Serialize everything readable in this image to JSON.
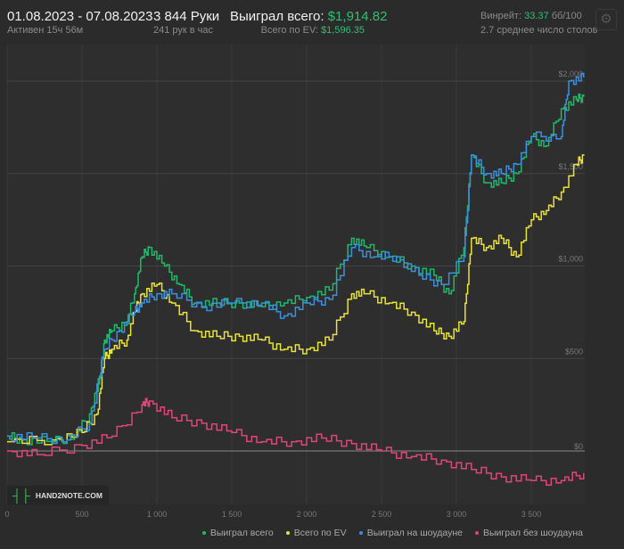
{
  "header": {
    "date_range": "01.08.2023 - 07.08.2023",
    "active": "Активен 15ч 56м",
    "hands": "3 844 Руки",
    "hands_per_hour": "241 рук в час",
    "won_label": "Выиграл всего:",
    "won_value": "$1,914.82",
    "ev_label": "Всего по EV:",
    "ev_value": "$1,596.35",
    "winrate_label": "Винрейт:",
    "winrate_value": "33.37",
    "winrate_unit": "бб/100",
    "tables": "2.7 среднее число столов",
    "settings_icon": "gear-icon"
  },
  "logo": "HAND2NOTE.COM",
  "chart_data": {
    "type": "line",
    "title": "",
    "xlabel": "",
    "ylabel": "",
    "xlim": [
      0,
      3850
    ],
    "ylim": [
      -300,
      2100
    ],
    "x_ticks": [
      "0",
      "500",
      "1 000",
      "1 500",
      "2 000",
      "2 500",
      "3 000",
      "3 500"
    ],
    "y_ticks": [
      "$0",
      "$500",
      "$1,000",
      "$1,500",
      "$2,000"
    ],
    "legend_position": "bottom-right",
    "series": [
      {
        "name": "Выиграл всего",
        "color": "#1fb86a",
        "points": [
          [
            0,
            80
          ],
          [
            100,
            60
          ],
          [
            300,
            50
          ],
          [
            450,
            80
          ],
          [
            550,
            200
          ],
          [
            620,
            400
          ],
          [
            650,
            600
          ],
          [
            700,
            650
          ],
          [
            800,
            700
          ],
          [
            850,
            850
          ],
          [
            900,
            1050
          ],
          [
            950,
            1100
          ],
          [
            1050,
            1000
          ],
          [
            1150,
            900
          ],
          [
            1250,
            800
          ],
          [
            1400,
            800
          ],
          [
            1550,
            800
          ],
          [
            1700,
            780
          ],
          [
            1850,
            800
          ],
          [
            2000,
            830
          ],
          [
            2150,
            870
          ],
          [
            2300,
            1150
          ],
          [
            2400,
            1100
          ],
          [
            2550,
            1050
          ],
          [
            2700,
            1000
          ],
          [
            2850,
            950
          ],
          [
            2950,
            850
          ],
          [
            3050,
            1100
          ],
          [
            3100,
            1600
          ],
          [
            3200,
            1450
          ],
          [
            3300,
            1450
          ],
          [
            3400,
            1500
          ],
          [
            3500,
            1700
          ],
          [
            3600,
            1650
          ],
          [
            3700,
            1850
          ],
          [
            3800,
            1900
          ],
          [
            3850,
            1915
          ]
        ]
      },
      {
        "name": "Всего по EV",
        "color": "#e8e23a",
        "points": [
          [
            0,
            50
          ],
          [
            300,
            60
          ],
          [
            500,
            100
          ],
          [
            600,
            200
          ],
          [
            650,
            500
          ],
          [
            700,
            550
          ],
          [
            800,
            600
          ],
          [
            850,
            750
          ],
          [
            900,
            850
          ],
          [
            1000,
            900
          ],
          [
            1100,
            800
          ],
          [
            1250,
            650
          ],
          [
            1400,
            620
          ],
          [
            1550,
            620
          ],
          [
            1700,
            600
          ],
          [
            1850,
            550
          ],
          [
            2000,
            550
          ],
          [
            2150,
            600
          ],
          [
            2300,
            850
          ],
          [
            2400,
            850
          ],
          [
            2550,
            800
          ],
          [
            2700,
            750
          ],
          [
            2850,
            650
          ],
          [
            2950,
            620
          ],
          [
            3050,
            700
          ],
          [
            3100,
            1150
          ],
          [
            3200,
            1100
          ],
          [
            3300,
            1150
          ],
          [
            3400,
            1050
          ],
          [
            3500,
            1250
          ],
          [
            3600,
            1300
          ],
          [
            3700,
            1400
          ],
          [
            3800,
            1550
          ],
          [
            3850,
            1596
          ]
        ]
      },
      {
        "name": "Выиграл на шоудауне",
        "color": "#3b8fe0",
        "points": [
          [
            0,
            80
          ],
          [
            200,
            70
          ],
          [
            400,
            60
          ],
          [
            550,
            150
          ],
          [
            650,
            550
          ],
          [
            750,
            650
          ],
          [
            850,
            750
          ],
          [
            900,
            800
          ],
          [
            1000,
            850
          ],
          [
            1100,
            850
          ],
          [
            1300,
            780
          ],
          [
            1500,
            800
          ],
          [
            1700,
            800
          ],
          [
            1850,
            730
          ],
          [
            2000,
            800
          ],
          [
            2150,
            820
          ],
          [
            2300,
            1100
          ],
          [
            2450,
            1050
          ],
          [
            2600,
            1050
          ],
          [
            2750,
            950
          ],
          [
            2900,
            900
          ],
          [
            3050,
            1050
          ],
          [
            3100,
            1600
          ],
          [
            3200,
            1500
          ],
          [
            3300,
            1500
          ],
          [
            3400,
            1550
          ],
          [
            3500,
            1700
          ],
          [
            3700,
            1700
          ],
          [
            3750,
            2000
          ],
          [
            3850,
            2020
          ]
        ]
      },
      {
        "name": "Выиграл без шоудауна",
        "color": "#e0457a",
        "points": [
          [
            0,
            0
          ],
          [
            200,
            -20
          ],
          [
            500,
            30
          ],
          [
            700,
            80
          ],
          [
            900,
            250
          ],
          [
            950,
            270
          ],
          [
            1100,
            180
          ],
          [
            1300,
            150
          ],
          [
            1500,
            100
          ],
          [
            1700,
            50
          ],
          [
            1900,
            50
          ],
          [
            2100,
            70
          ],
          [
            2300,
            40
          ],
          [
            2500,
            0
          ],
          [
            2700,
            -30
          ],
          [
            2900,
            -50
          ],
          [
            3100,
            -100
          ],
          [
            3300,
            -140
          ],
          [
            3500,
            -160
          ],
          [
            3700,
            -160
          ],
          [
            3850,
            -120
          ]
        ]
      }
    ]
  }
}
